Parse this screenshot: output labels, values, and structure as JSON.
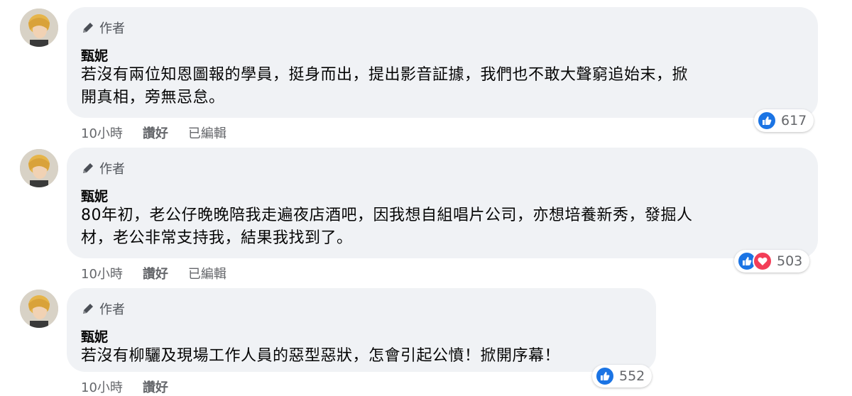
{
  "author_badge": "作者",
  "comments": [
    {
      "name": "甄妮",
      "text": "若沒有兩位知恩圖報的學員，挺身而出，提出影音証據，我們也不敢大聲窮追始末，掀\n開真相，旁無忌怠。",
      "reaction_count": "617",
      "reactions": [
        "like"
      ],
      "time": "10小時",
      "like_label": "讚好",
      "edited_label": "已編輯"
    },
    {
      "name": "甄妮",
      "text": "80年初，老公仔晚晚陪我走遍夜店酒吧，因我想自組唱片公司，亦想培養新秀，發掘人\n材，老公非常支持我，結果我找到了。",
      "reaction_count": "503",
      "reactions": [
        "like",
        "love"
      ],
      "time": "10小時",
      "like_label": "讚好",
      "edited_label": "已編輯"
    },
    {
      "name": "甄妮",
      "text": "若沒有柳驪及現場工作人員的惡型惡狀，怎會引起公憤！掀開序幕！",
      "reaction_count": "552",
      "reactions": [
        "like"
      ],
      "time": "10小時",
      "like_label": "讚好"
    }
  ],
  "colors": {
    "bubble": "#f0f2f5",
    "like": "#1b74e4",
    "love": "#f33e58",
    "meta_text": "#65676b"
  }
}
